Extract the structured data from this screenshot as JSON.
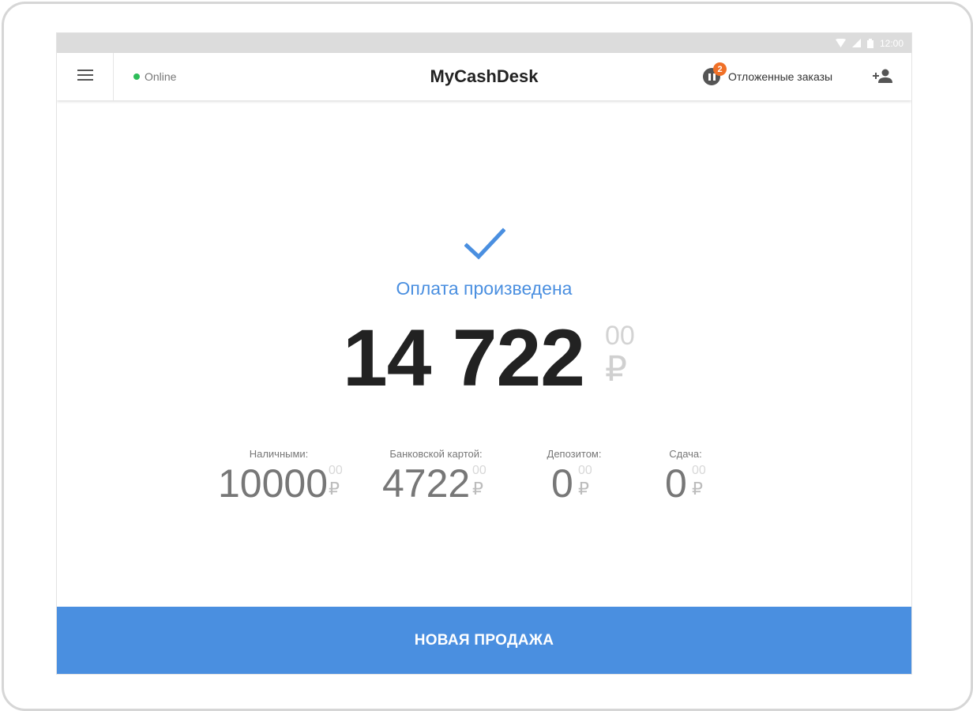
{
  "status_bar": {
    "time": "12:00"
  },
  "app_bar": {
    "menu_icon": "hamburger-menu-icon",
    "online_label": "Online",
    "online_color": "#2ebd59",
    "title": "MyCashDesk",
    "deferred_orders_label": "Отложенные заказы",
    "deferred_orders_count": "2",
    "badge_color": "#f07027",
    "add_user_icon": "person-add-icon"
  },
  "payment": {
    "status_icon": "checkmark-icon",
    "message": "Оплата произведена",
    "total": "14 722",
    "total_kopecks": "00",
    "currency": "₽"
  },
  "breakdown": [
    {
      "label": "Наличными:",
      "amount": "10000",
      "kopecks": "00",
      "currency": "₽"
    },
    {
      "label": "Банковской картой:",
      "amount": "4722",
      "kopecks": "00",
      "currency": "₽"
    },
    {
      "label": "Депозитом:",
      "amount": "0",
      "kopecks": "00",
      "currency": "₽"
    },
    {
      "label": "Сдача:",
      "amount": "0",
      "kopecks": "00",
      "currency": "₽"
    }
  ],
  "actions": {
    "new_sale_label": "НОВАЯ ПРОДАЖА"
  },
  "colors": {
    "accent": "#4a8fe0"
  }
}
